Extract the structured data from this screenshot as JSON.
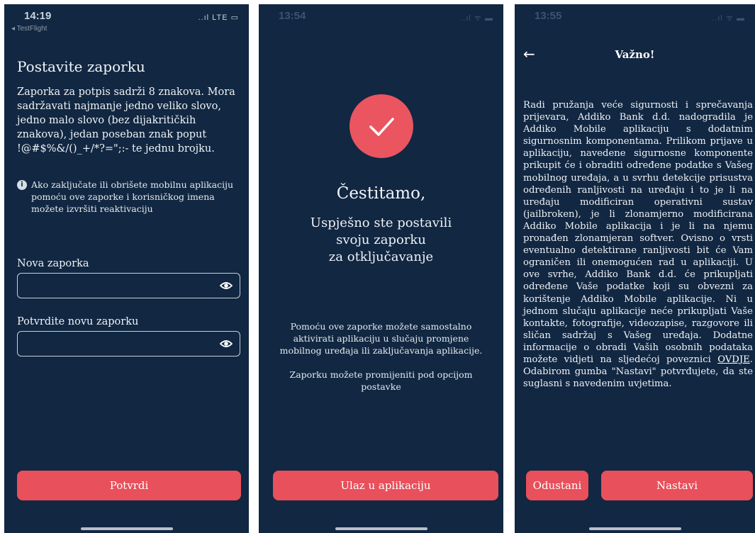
{
  "screens": [
    {
      "status": {
        "time": "14:19",
        "back_app": "◂ TestFlight",
        "icons": "..ıl LTE ▭"
      },
      "title": "Postavite zaporku",
      "description": "Zaporka za potpis sadrži 8 znakova. Mora sadržavati najmanje jedno veliko slovo, jedno malo slovo (bez dijakritičkih znakova), jedan poseban znak poput !@#$%&/()_+/*?=\";:- te jednu brojku.",
      "info_icon": "info-icon",
      "info": "Ako zaključate ili obrišete mobilnu aplikaciju pomoću ove zaporke i korisničkog imena možete izvršiti reaktivaciju",
      "new_password_label": "Nova zaporka",
      "confirm_password_label": "Potvrdite novu zaporku",
      "confirm_button": "Potvrdi"
    },
    {
      "status": {
        "time": "13:54",
        "icons": "..ıl ᯤ ▬"
      },
      "check_icon": "checkmark-icon",
      "congrats": "Čestitamo,",
      "success_line1": "Uspješno ste postavili",
      "success_line2": "svoju zaporku",
      "success_line3": "za otključavanje",
      "note1": "Pomoću ove zaporke možete samostalno aktivirati aplikaciju u slučaju promjene mobilnog uređaja ili zaključavanja aplikacije.",
      "note2": "Zaporku možete promijeniti pod opcijom postavke",
      "enter_button": "Ulaz u aplikaciju"
    },
    {
      "status": {
        "time": "13:55",
        "icons": "..ıl ᯤ ▬"
      },
      "back_icon": "back-arrow-icon",
      "title": "Važno!",
      "body_before_link": "Radi pružanja veće sigurnosti i sprečavanja prijevara, Addiko Bank d.d. nadogradila je Addiko Mobile aplikaciju s dodatnim sigurnosnim komponentama. Prilikom prijave u aplikaciju, navedene sigurnosne komponente prikupit će i obraditi određene podatke s Vašeg mobilnog uređaja, a u svrhu detekcije prisustva određenih ranljivosti na uređaju i to je li na uređaju modificiran operativni sustav (jailbroken), je li zlonamjerno modificirana Addiko Mobile aplikacija i je li na njemu pronađen zlonamjeran softver. Ovisno o vrsti eventualno detektirane ranljivosti bit će Vam ograničen ili onemogućen rad u aplikaciji. U ove svrhe, Addiko Bank d.d. će prikupljati određene Vaše podatke koji su obvezni za korištenje Addiko Mobile aplikacije. Ni u jednom slučaju aplikacije neće prikupljati Vaše kontakte, fotografije, videozapise, razgovore ili sličan sadržaj s Vašeg uređaja. Dodatne informacije o obradi Vaših osobnih podataka možete vidjeti na sljedećoj poveznici ",
      "link": "OVDJE",
      "body_after_link": ". Odabirom gumba \"Nastavi\" potvrđujete, da ste suglasni s navedenim uvjetima.",
      "cancel_button": "Odustani",
      "continue_button": "Nastavi"
    }
  ]
}
